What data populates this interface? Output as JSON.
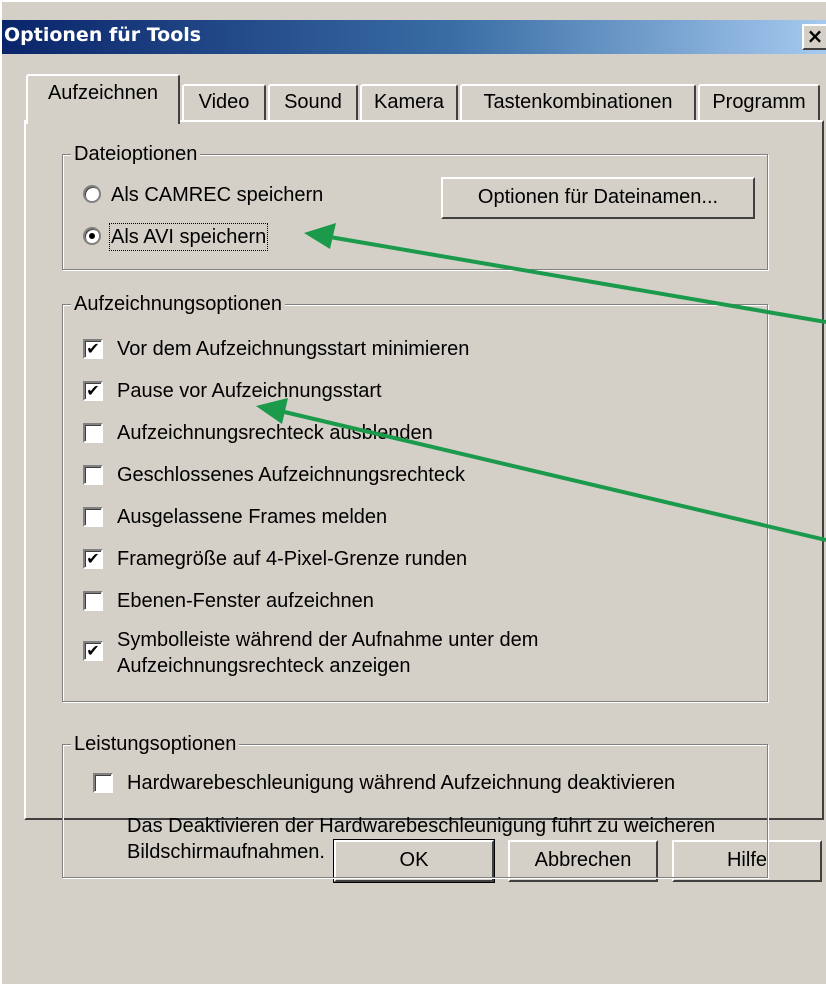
{
  "window": {
    "title": "Optionen für Tools",
    "close": "×"
  },
  "tabs": [
    {
      "label": "Aufzeichnen",
      "active": true
    },
    {
      "label": "Video"
    },
    {
      "label": "Sound"
    },
    {
      "label": "Kamera"
    },
    {
      "label": "Tastenkombinationen"
    },
    {
      "label": "Programm"
    }
  ],
  "file_options": {
    "legend": "Dateioptionen",
    "radio_camrec": "Als CAMREC speichern",
    "radio_avi": "Als AVI speichern",
    "selected": "avi",
    "filename_button": "Optionen für Dateinamen..."
  },
  "recording_options": {
    "legend": "Aufzeichnungsoptionen",
    "items": [
      {
        "label": "Vor dem Aufzeichnungsstart minimieren",
        "checked": true
      },
      {
        "label": "Pause vor Aufzeichnungsstart",
        "checked": true
      },
      {
        "label": "Aufzeichnungsrechteck ausblenden",
        "checked": false
      },
      {
        "label": "Geschlossenes Aufzeichnungsrechteck",
        "checked": false
      },
      {
        "label": "Ausgelassene Frames melden",
        "checked": false
      },
      {
        "label": "Framegröße auf 4-Pixel-Grenze runden",
        "checked": true
      },
      {
        "label": "Ebenen-Fenster aufzeichnen",
        "checked": false
      },
      {
        "label": "Symbolleiste während der Aufnahme unter dem Aufzeichnungsrechteck anzeigen",
        "checked": true
      }
    ]
  },
  "performance_options": {
    "legend": "Leistungsoptionen",
    "hw_label": "Hardwarebeschleunigung während Aufzeichnung deaktivieren",
    "hw_checked": false,
    "description": "Das Deaktivieren der Hardwarebeschleunigung führt zu weicheren Bildschirmaufnahmen."
  },
  "buttons": {
    "ok": "OK",
    "cancel": "Abbrechen",
    "help": "Hilfe"
  },
  "colors": {
    "title_start": "#0a246a",
    "title_end": "#a6caf0",
    "face": "#d4d0c8",
    "arrow": "#1a9a4a"
  },
  "icons": {
    "check": "check-mark-icon",
    "arrow": "pointer-arrow-icon"
  }
}
